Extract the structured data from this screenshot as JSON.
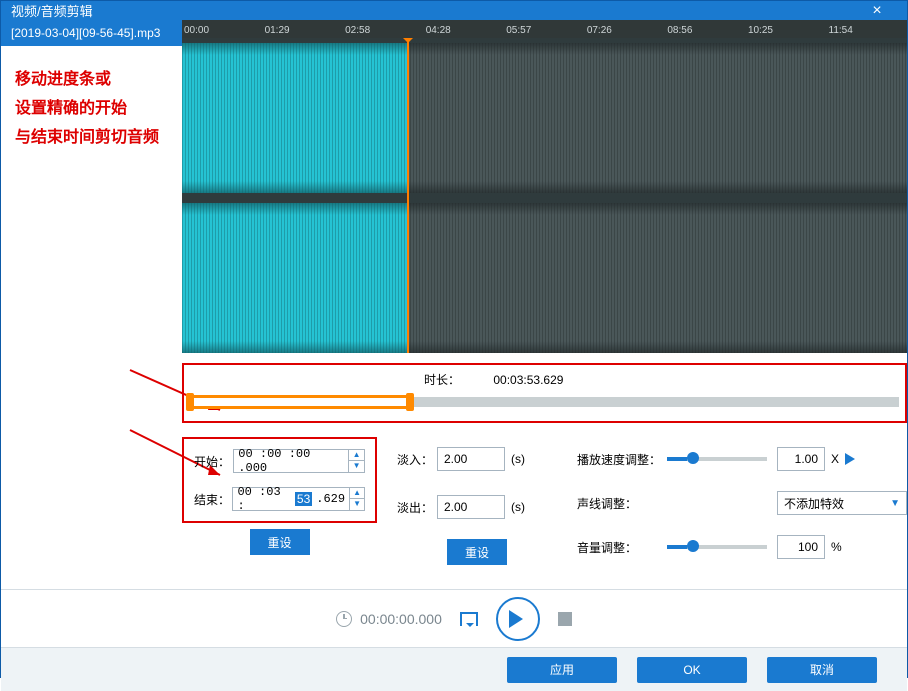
{
  "window": {
    "title": "视频/音频剪辑"
  },
  "file": {
    "name": "[2019-03-04][09-56-45].mp3"
  },
  "annotation": {
    "line1": "移动进度条或",
    "line2": "设置精确的开始",
    "line3": "与结束时间剪切音频"
  },
  "ruler": [
    "00:00",
    "01:29",
    "02:58",
    "04:28",
    "05:57",
    "07:26",
    "08:56",
    "10:25",
    "11:54"
  ],
  "range": {
    "duration_label": "时长：",
    "duration_value": "00:03:53.629"
  },
  "start": {
    "label": "开始：",
    "value": "00 :00 :00 .000"
  },
  "end": {
    "label": "结束：",
    "prefix": "00 :03 :",
    "sel": "53",
    "suffix": ".629"
  },
  "fadein": {
    "label": "淡入：",
    "value": "2.00",
    "unit": "(s)"
  },
  "fadeout": {
    "label": "淡出：",
    "value": "2.00",
    "unit": "(s)"
  },
  "speed": {
    "label": "播放速度调整：",
    "value": "1.00",
    "unit": "X"
  },
  "voice": {
    "label": "声线调整：",
    "value": "不添加特效"
  },
  "volume": {
    "label": "音量调整：",
    "value": "100",
    "unit": "%"
  },
  "buttons": {
    "reset": "重设",
    "apply": "应用",
    "ok": "OK",
    "cancel": "取消"
  },
  "transport": {
    "time": "00:00:00.000"
  }
}
